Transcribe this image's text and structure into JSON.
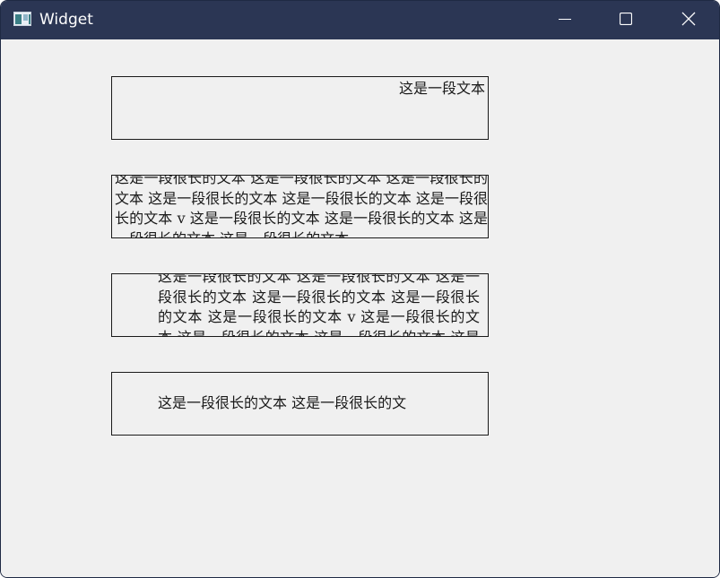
{
  "window": {
    "title": "Widget",
    "app_icon": "qt-window-icon",
    "controls": {
      "minimize_icon": "minimize-icon",
      "maximize_icon": "maximize-icon",
      "close_icon": "close-icon"
    }
  },
  "labels": [
    {
      "text": "这是一段文本",
      "align": "right-top"
    },
    {
      "text": "这是一段很长的文本 这是一段很长的文本 这是一段很长的文本 这是一段很长的文本 这是一段很长的文本 这是一段很长的文本 v 这是一段很长的文本 这是一段很长的文本 这是一段很长的文本 这是一段很长的文本",
      "align": "justify-wrap"
    },
    {
      "text": "这是一段很长的文本 这是一段很长的文本 这是一段很长的文本 这是一段很长的文本 这是一段很长的文本 这是一段很长的文本 v 这是一段很长的文本 这是一段很长的文本 这是一段很长的文本 这是一段很长的文本",
      "align": "indented-wrap"
    },
    {
      "text": "这是一段很长的文本 这是一段很长的文",
      "align": "indented-center"
    }
  ],
  "colors": {
    "titlebar": "#2b3654",
    "client_bg": "#f0f0f0",
    "border": "#1a1a1a"
  }
}
